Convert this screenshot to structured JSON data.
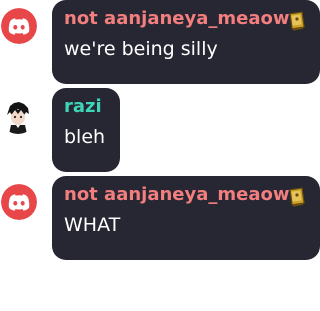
{
  "messages": [
    {
      "author": "not aanjaneya_meaow",
      "author_color": "#f27e7e",
      "text": "we're being silly",
      "avatar": "discord-default-avatar-red",
      "badge": "book-badge-icon"
    },
    {
      "author": "razi",
      "author_color": "#3ed6b8",
      "text": "bleh",
      "avatar": "anime-boy-avatar",
      "badge": ""
    },
    {
      "author": "not aanjaneya_meaow",
      "author_color": "#f27e7e",
      "text": "WHAT",
      "avatar": "discord-default-avatar-red",
      "badge": "book-badge-icon"
    }
  ],
  "colors": {
    "bubble": "#272633",
    "discord_red": "#e8474a"
  }
}
